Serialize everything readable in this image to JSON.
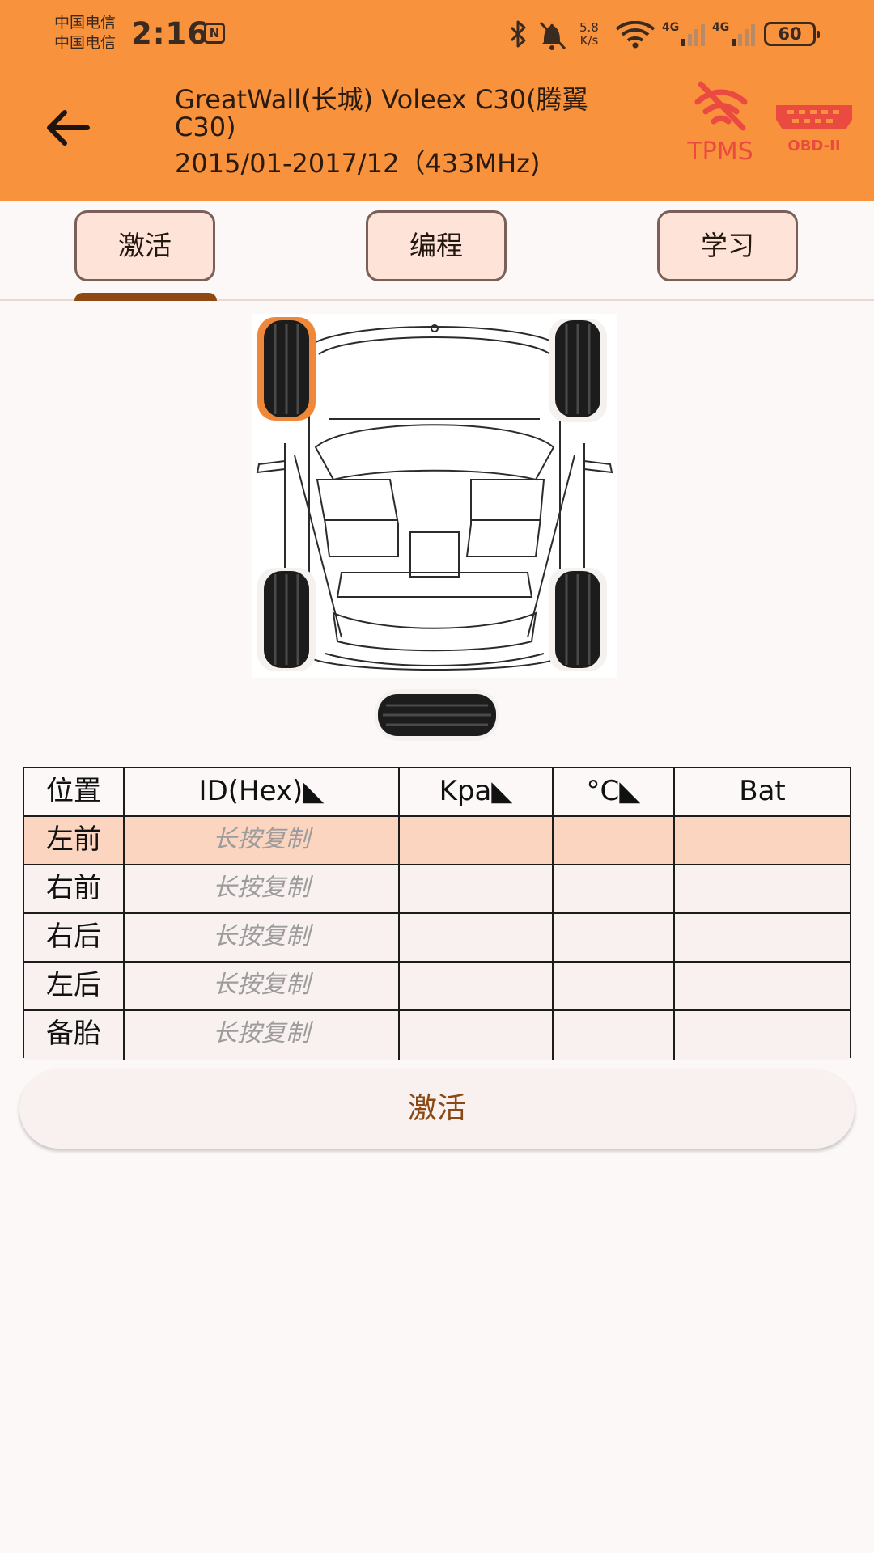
{
  "status_bar": {
    "carrier_1": "中国电信",
    "carrier_2": "中国电信",
    "time": "2:16",
    "nfc": "N",
    "speed_value": "5.8",
    "speed_unit": "K/s",
    "network_1": "4G",
    "network_2": "4G",
    "battery": "60"
  },
  "app_bar": {
    "title_line_1": "GreatWall(长城) Voleex C30(腾翼",
    "title_line_2": "C30)",
    "title_line_3": "2015/01-2017/12（433MHz)",
    "tpms_logo_text": "TPMS",
    "obd_logo_text": "OBD-II"
  },
  "tabs": [
    {
      "label": "激活",
      "selected": true
    },
    {
      "label": "编程",
      "selected": false
    },
    {
      "label": "学习",
      "selected": false
    }
  ],
  "table": {
    "headers": [
      "位置",
      "ID(Hex)◣",
      "Kpa◣",
      "°C◣",
      "Bat"
    ],
    "rows": [
      {
        "position": "左前",
        "id_hint": "长按复制",
        "kpa": "",
        "temp": "",
        "bat": "",
        "highlighted": true
      },
      {
        "position": "右前",
        "id_hint": "长按复制",
        "kpa": "",
        "temp": "",
        "bat": "",
        "highlighted": false
      },
      {
        "position": "右后",
        "id_hint": "长按复制",
        "kpa": "",
        "temp": "",
        "bat": "",
        "highlighted": false
      },
      {
        "position": "左后",
        "id_hint": "长按复制",
        "kpa": "",
        "temp": "",
        "bat": "",
        "highlighted": false
      },
      {
        "position": "备胎",
        "id_hint": "长按复制",
        "kpa": "",
        "temp": "",
        "bat": "",
        "highlighted": false
      }
    ]
  },
  "activate_button": {
    "label": "激活"
  },
  "colors": {
    "app_bar": "#f8923d",
    "accent": "#8d4a12",
    "selected_wheel": "#f0883a",
    "row_highlight": "#fbd5c0",
    "logo_red": "#ea4a3f"
  },
  "icons": [
    "back-arrow-icon",
    "bluetooth-icon",
    "mute-bell-icon",
    "wifi-icon",
    "signal-icon",
    "battery-icon",
    "nfc-icon"
  ]
}
